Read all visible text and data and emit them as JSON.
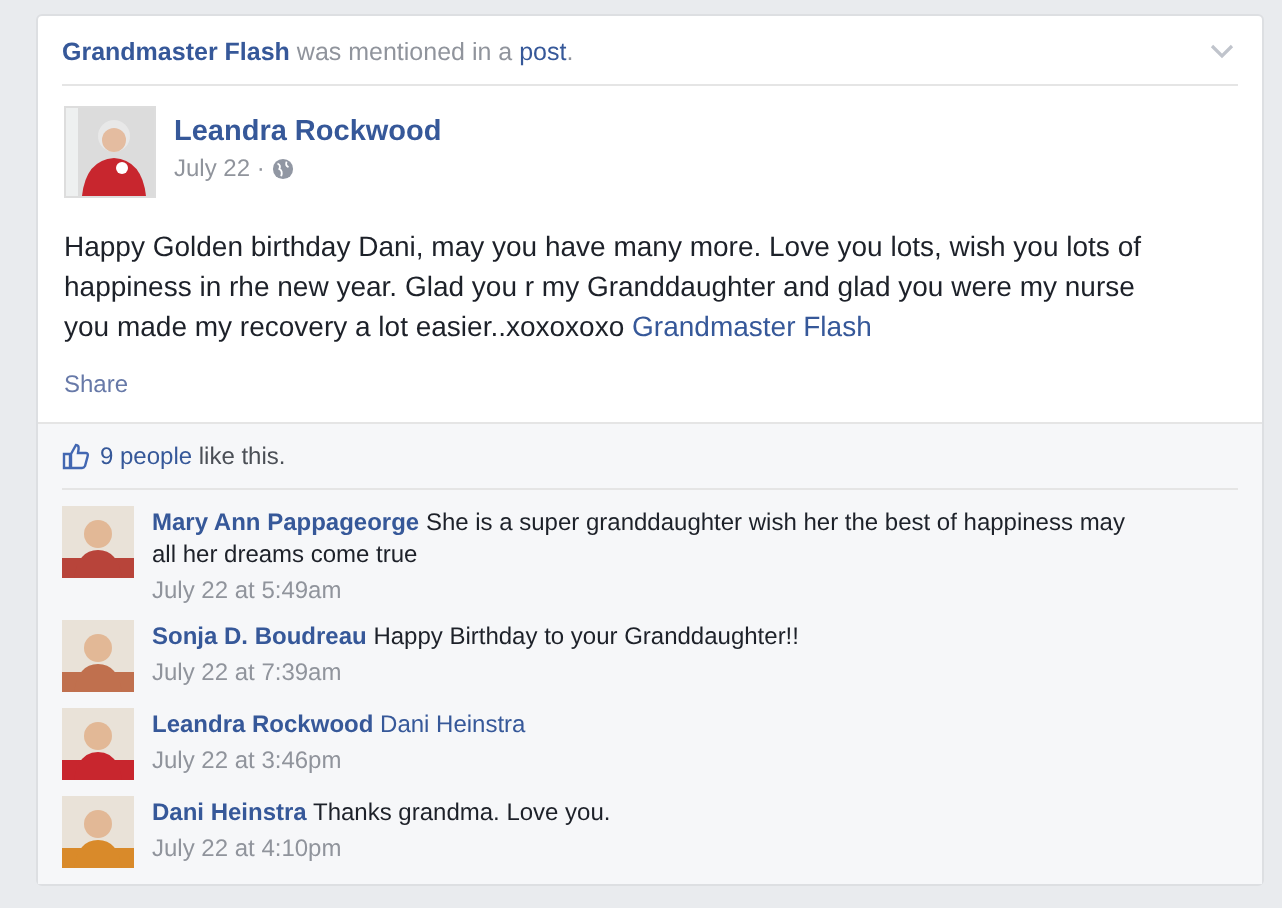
{
  "mention": {
    "actor": "Grandmaster Flash",
    "middle": "was mentioned in a",
    "object": "post",
    "end": "."
  },
  "post": {
    "author": "Leandra Rockwood",
    "date": "July 22 ·",
    "body": "Happy Golden birthday Dani, may you have many more. Love you lots, wish you lots of happiness in rhe new year. Glad you r my Granddaughter and glad you were my nurse you made my recovery a lot easier..xoxoxoxo",
    "tag": "Grandmaster Flash",
    "share": "Share"
  },
  "likes": {
    "count": "9 people",
    "text": "like this."
  },
  "comments": [
    {
      "author": "Mary Ann Pappageorge",
      "kind": "text",
      "text": "She is a super granddaughter wish her the best of happiness may all her dreams come true",
      "time": "July 22 at 5:49am"
    },
    {
      "author": "Sonja D. Boudreau",
      "kind": "text",
      "text": "Happy Birthday to your Granddaughter!!",
      "time": "July 22 at 7:39am"
    },
    {
      "author": "Leandra Rockwood",
      "kind": "tag",
      "text": "Dani Heinstra",
      "time": "July 22 at 3:46pm"
    },
    {
      "author": "Dani Heinstra",
      "kind": "text",
      "text": "Thanks grandma. Love you.",
      "time": "July 22 at 4:10pm"
    }
  ]
}
